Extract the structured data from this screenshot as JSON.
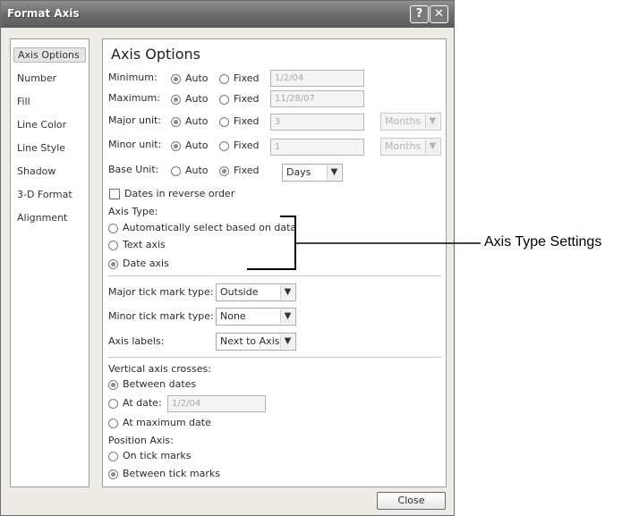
{
  "window": {
    "title": "Format Axis",
    "help_label": "?",
    "close_label": "✕"
  },
  "nav": {
    "items": [
      "Axis Options",
      "Number",
      "Fill",
      "Line Color",
      "Line Style",
      "Shadow",
      "3-D Format",
      "Alignment"
    ],
    "selected": "Axis Options"
  },
  "panel": {
    "heading": "Axis Options",
    "auto_label": "Auto",
    "fixed_label": "Fixed",
    "minimum": {
      "label": "Minimum:",
      "mode": "Auto",
      "value": "1/2/04"
    },
    "maximum": {
      "label": "Maximum:",
      "mode": "Auto",
      "value": "11/28/07"
    },
    "major_unit": {
      "label": "Major unit:",
      "mode": "Auto",
      "value": "3",
      "unit": "Months"
    },
    "minor_unit": {
      "label": "Minor unit:",
      "mode": "Auto",
      "value": "1",
      "unit": "Months"
    },
    "base_unit": {
      "label": "Base Unit:",
      "mode": "Fixed",
      "value": "Days"
    },
    "reverse_order": {
      "label": "Dates in reverse order",
      "checked": false
    },
    "axis_type": {
      "label": "Axis Type:",
      "options": [
        "Automatically select based on data",
        "Text axis",
        "Date axis"
      ],
      "selected": "Date axis"
    },
    "major_tick": {
      "label": "Major tick mark type:",
      "value": "Outside"
    },
    "minor_tick": {
      "label": "Minor tick mark type:",
      "value": "None"
    },
    "axis_labels": {
      "label": "Axis labels:",
      "value": "Next to Axis"
    },
    "vertical_crosses": {
      "label": "Vertical axis crosses:",
      "between_dates": "Between dates",
      "at_date": "At date:",
      "at_date_value": "1/2/04",
      "at_max": "At maximum date",
      "selected": "Between dates"
    },
    "position_axis": {
      "label": "Position Axis:",
      "options": [
        "On tick marks",
        "Between tick marks"
      ],
      "selected": "Between tick marks"
    }
  },
  "footer": {
    "close_label": "Close"
  },
  "callout": {
    "label": "Axis Type Settings"
  },
  "colors": {
    "titlebar": "#6a6a6a",
    "dialog_bg": "#ecebe6",
    "panel_bg": "#ffffff"
  }
}
